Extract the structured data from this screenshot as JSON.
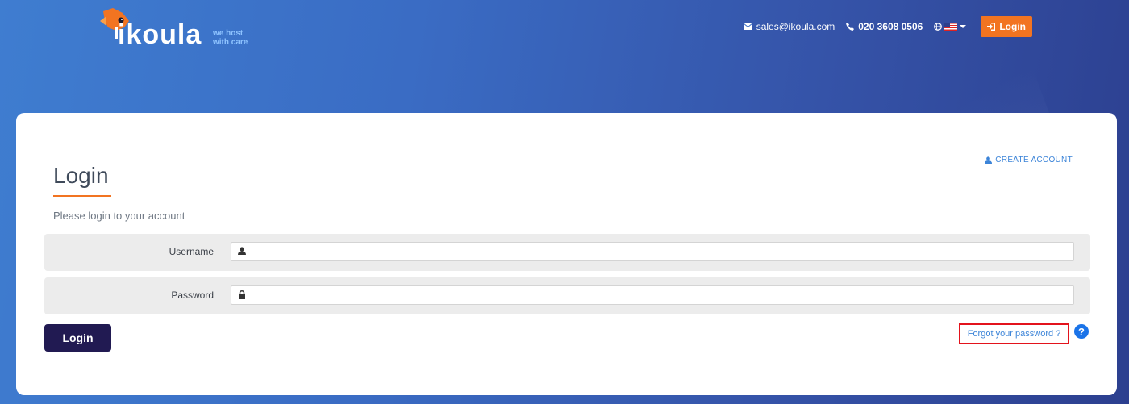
{
  "header": {
    "logo_word": "ikoula",
    "logo_tagline_1": "we host",
    "logo_tagline_2": "with care",
    "email": "sales@ikoula.com",
    "phone": "020 3608 0506",
    "login_label": "Login",
    "language_flag": "us-flag"
  },
  "card": {
    "title": "Login",
    "subtitle": "Please login to your account",
    "create_account": "CREATE ACCOUNT",
    "username_label": "Username",
    "username_value": "",
    "password_label": "Password",
    "password_value": "",
    "login_button": "Login",
    "forgot_password": "Forgot your password ?",
    "help": "?"
  },
  "colors": {
    "accent": "#f27421",
    "button": "#211a52",
    "link": "#3c84d8",
    "highlight": "#e3131c"
  }
}
